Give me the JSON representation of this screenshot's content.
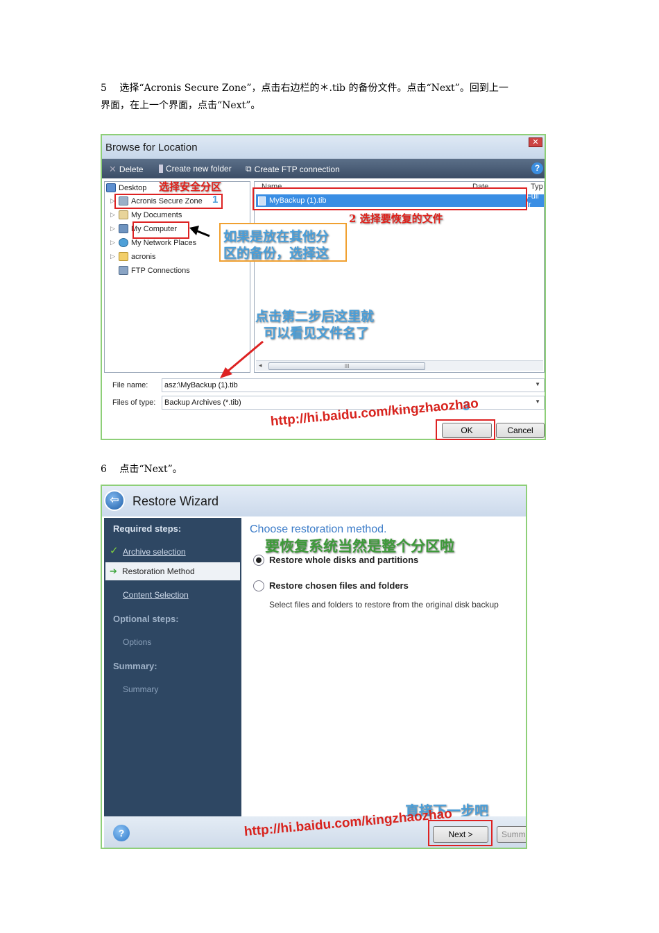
{
  "step5": {
    "text_line1": "5　 选择“Acronis Secure Zone”，点击右边栏的＊.tib 的备份文件。点击“Next”。回到上一",
    "text_line2": "界面，在上一个界面，点击“Next”。"
  },
  "browse_dialog": {
    "title": "Browse for Location",
    "close_label": "✕",
    "toolbar": {
      "delete": "Delete",
      "create_folder": "Create new folder",
      "create_ftp": "Create FTP connection",
      "help": "?"
    },
    "tree": {
      "desktop": "Desktop",
      "items": [
        "Acronis Secure Zone",
        "My Documents",
        "My Computer",
        "My Network Places",
        "acronis",
        "FTP Connections"
      ]
    },
    "columns": [
      "Name",
      "Date",
      "Typ"
    ],
    "file_row": {
      "name": "MyBackup (1).tib",
      "type": "Full Ir"
    },
    "scroll_grip": "III",
    "file_name_label": "File name:",
    "file_name_value": "asz:\\MyBackup (1).tib",
    "file_type_label": "Files of type:",
    "file_type_value": "Backup Archives (*.tib)",
    "ok_label": "OK",
    "cancel_label": "Cancel"
  },
  "annotations1": {
    "select_zone": "选择安全分区",
    "num1": "1",
    "select_file": "2  选择要恢复的文件",
    "other_partition_l1": "如果是放在其他分",
    "other_partition_l2": "区的备份，选择这",
    "after_step2_l1": "点击第二步后这里就",
    "after_step2_l2": "可以看见文件名了",
    "num3": "3",
    "url": "http://hi.baidu.com/kingzhaozhao"
  },
  "step6": {
    "text": "6　 点击“Next”。"
  },
  "restore_wizard": {
    "title": "Restore Wizard",
    "required_steps": "Required steps:",
    "archive_selection": "Archive selection",
    "restoration_method": "Restoration Method",
    "content_selection": "Content Selection",
    "optional_steps": "Optional steps:",
    "options": "Options",
    "summary_h": "Summary:",
    "summary": "Summary",
    "heading": "Choose restoration method.",
    "annotation_whole": "要恢复系统当然是整个分区啦",
    "option1": "Restore whole disks and partitions",
    "option2": "Restore chosen files and folders",
    "option2_desc": "Select files and folders to restore from the original disk backup",
    "annotation_next": "直接下一步吧",
    "url": "http://hi.baidu.com/kingzhaozhao",
    "next_label": "Next >",
    "summ_label": "Summ",
    "help": "?"
  }
}
